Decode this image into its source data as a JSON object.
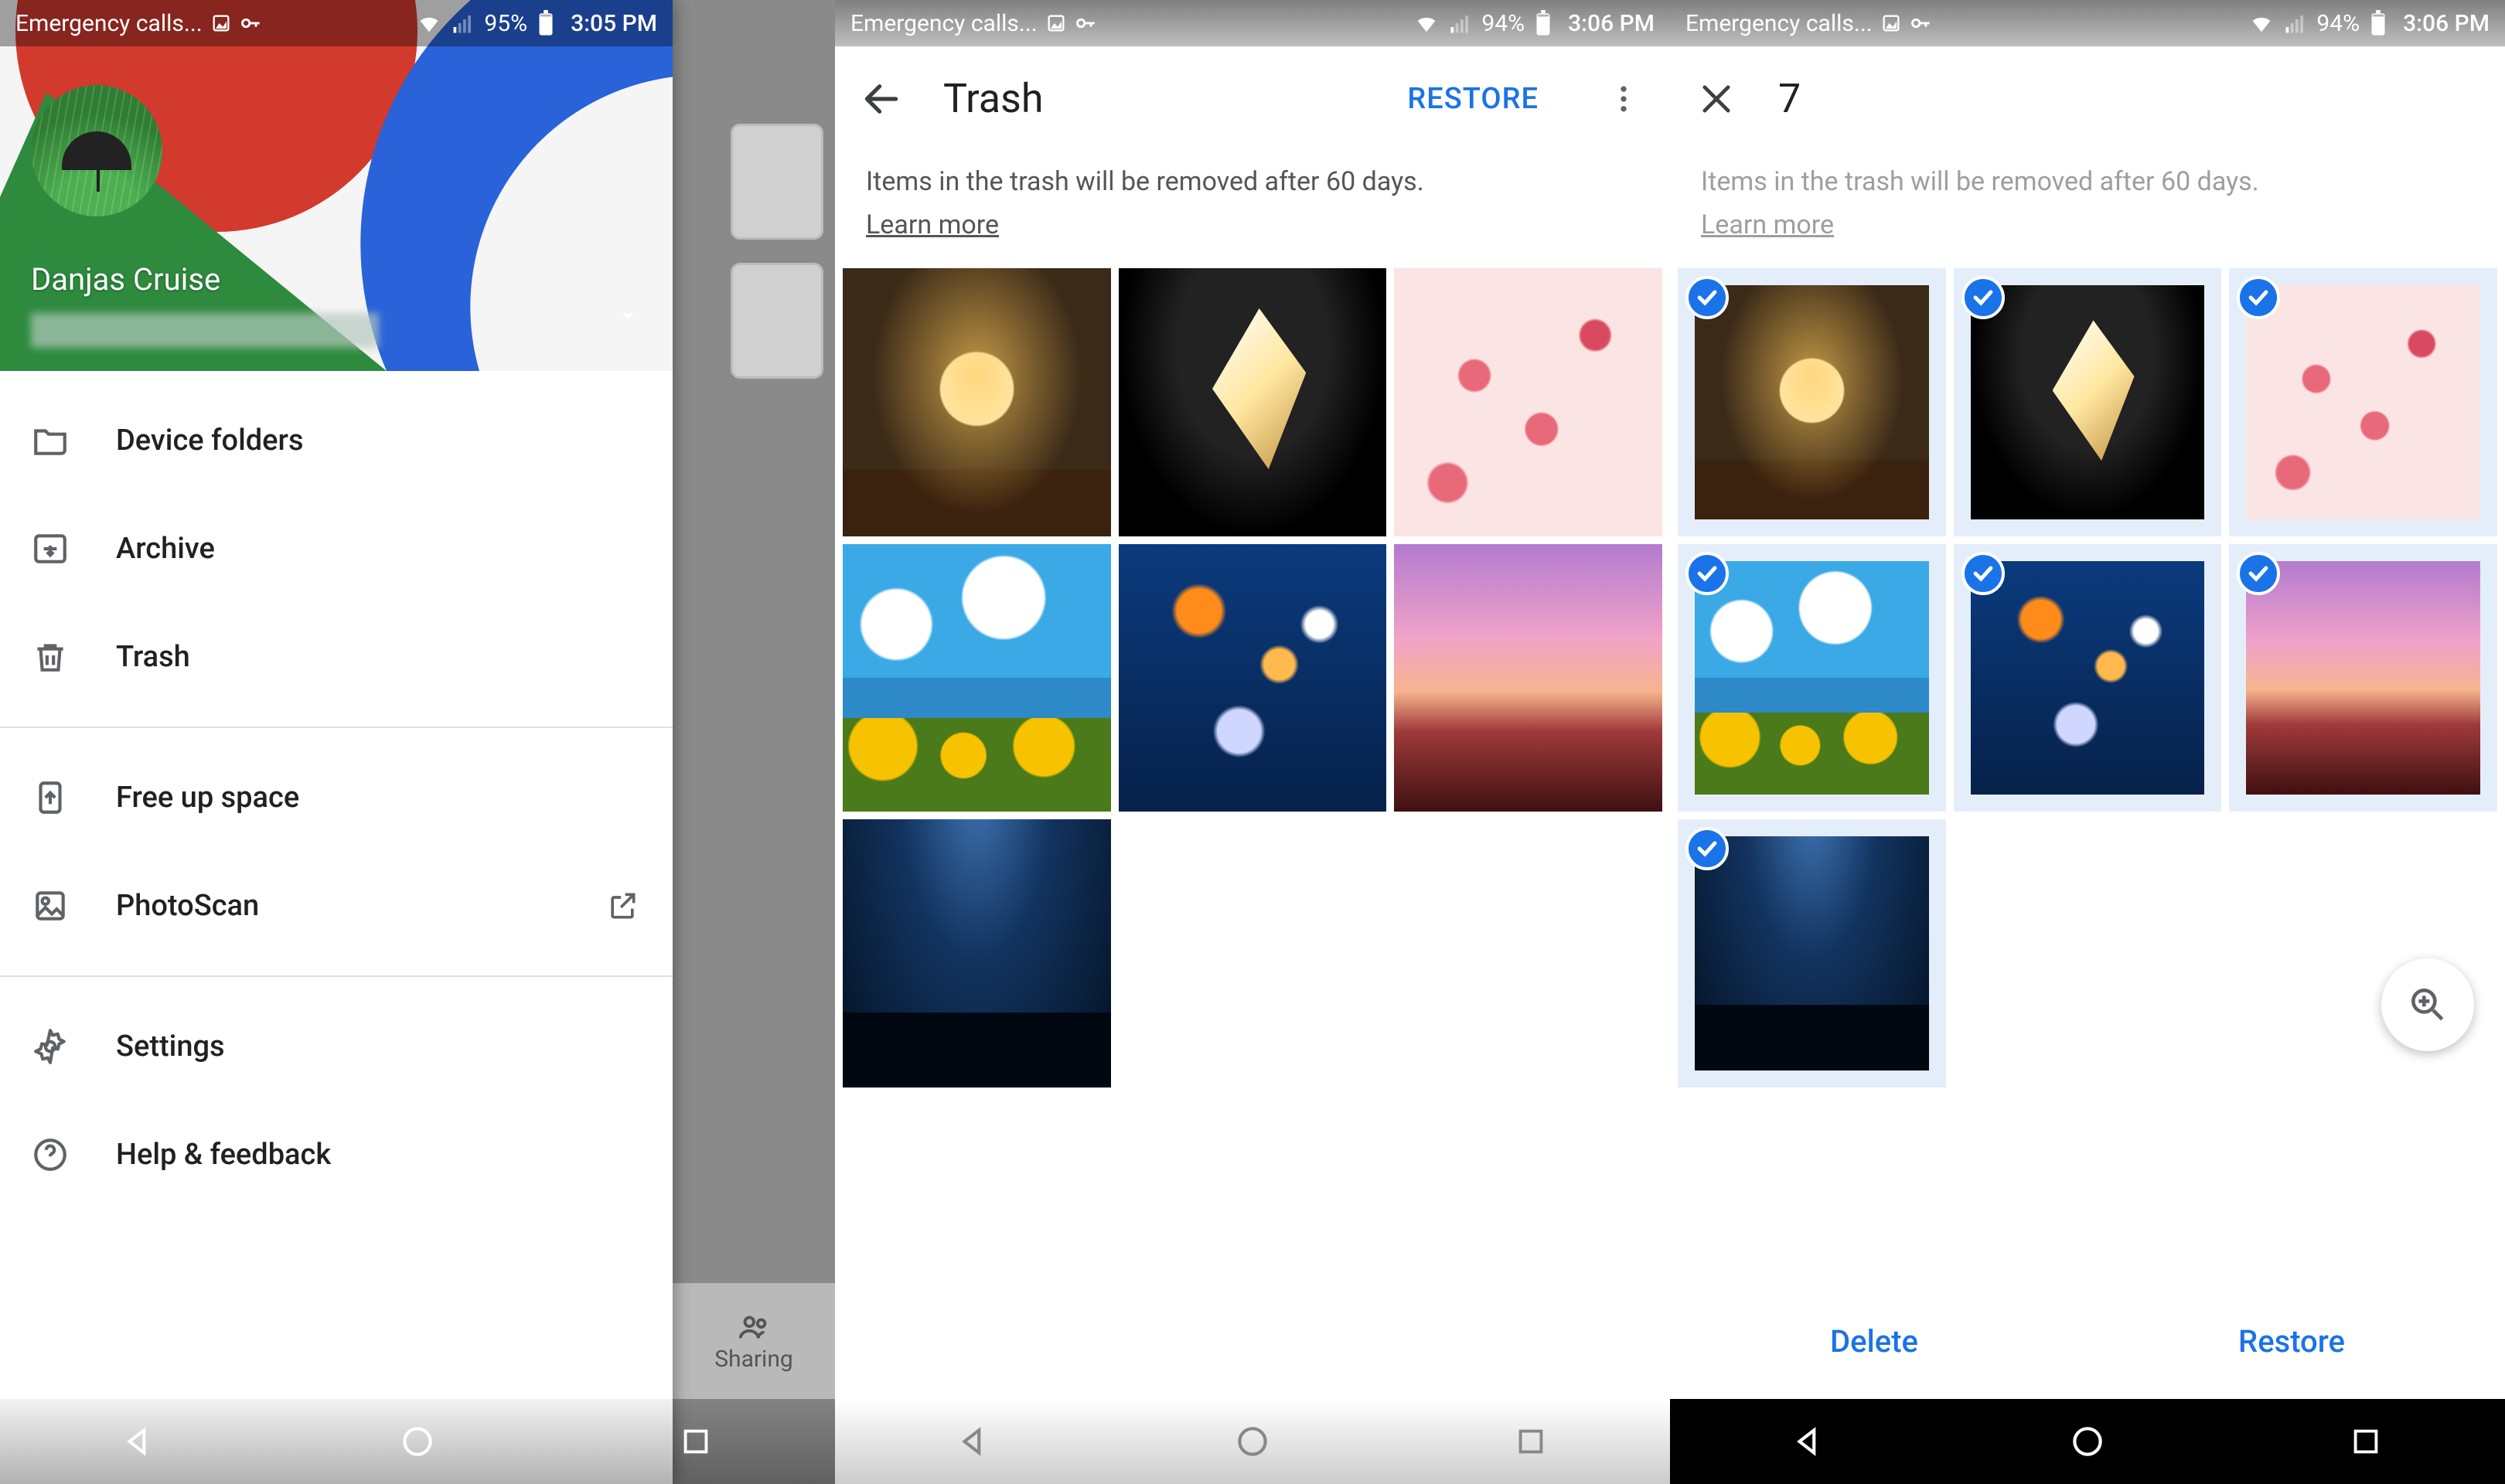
{
  "statusbars": {
    "screen1": {
      "leftText": "Emergency calls...",
      "battery": "95%",
      "time": "3:05 PM"
    },
    "screen2": {
      "leftText": "Emergency calls...",
      "battery": "94%",
      "time": "3:06 PM"
    },
    "screen3": {
      "leftText": "Emergency calls...",
      "battery": "94%",
      "time": "3:06 PM"
    }
  },
  "drawer": {
    "accountName": "Danjas Cruise",
    "items": {
      "deviceFolders": "Device folders",
      "archive": "Archive",
      "trash": "Trash",
      "freeUpSpace": "Free up space",
      "photoScan": "PhotoScan",
      "settings": "Settings",
      "helpFeedback": "Help & feedback"
    },
    "backgroundTabLabel": "Sharing"
  },
  "trash": {
    "title": "Trash",
    "restoreAction": "RESTORE",
    "infoLine": "Items in the trash will be removed after 60 days.",
    "learnMore": "Learn more"
  },
  "selection": {
    "count": "7",
    "infoLine": "Items in the trash will be removed after 60 days.",
    "learnMore": "Learn more",
    "deleteAction": "Delete",
    "restoreAction": "Restore"
  }
}
